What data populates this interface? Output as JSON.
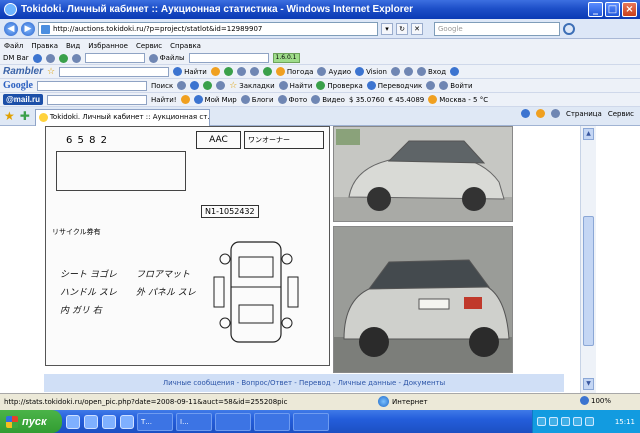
{
  "window": {
    "title": "Tokidoki. Личный кабинет :: Аукционная статистика - Windows Internet Explorer",
    "minimize": "_",
    "maximize": "□",
    "close": "×"
  },
  "address": {
    "url": "http://auctions.tokidoki.ru/?p=project/statlot&id=12989907",
    "search_placeholder": "Google"
  },
  "menu": [
    "Файл",
    "Правка",
    "Вид",
    "Избранное",
    "Сервис",
    "Справка"
  ],
  "toolbar_dm": {
    "label": "DM Bar",
    "files": "Файлы",
    "counter": "1.6.0.1"
  },
  "toolbar_rambler": {
    "brand": "Rambler",
    "find": "Найти",
    "weather": "Погода",
    "audio": "Аудио",
    "vision": "Vision",
    "login": "Вход"
  },
  "toolbar_google": {
    "brand": "Google",
    "search": "Поиск",
    "bookmarks": "Закладки",
    "find": "Найти",
    "check": "Проверка",
    "translate": "Переводчик",
    "signin": "Войти"
  },
  "toolbar_mailru": {
    "brand": "@mail.ru",
    "find": "Найти!",
    "my_world": "Мой Мир",
    "blogs": "Блоги",
    "photo": "Фото",
    "video": "Видео",
    "usd": "$ 35.0760",
    "eur": "€ 45.4089",
    "weather": "Москва - 5 °C"
  },
  "tabs": {
    "active": "Tokidoki. Личный кабинет :: Аукционная ст...",
    "page": "Страница",
    "tools": "Сервис"
  },
  "sheet": {
    "grade_label": "AAC",
    "number": "6 5 8 2",
    "recycle": "リサイクル券有",
    "code": "N1-1052432",
    "notes": "ワンオーナー",
    "hw1": "シート ヨゴレ",
    "hw2": "ハンドル スレ",
    "hw3": "外 パネル スレ",
    "hw4": "内 ガリ 右",
    "hw5": "フロアマット"
  },
  "footer_links": "Личные сообщения - Вопрос/Ответ - Перевод - Личные данные - Документы",
  "status": {
    "url": "http://stats.tokidoki.ru/open_pic.php?date=2008-09-11&auct=58&id=255208pic",
    "zone": "Интернет",
    "zoom": "100%"
  },
  "taskbar": {
    "start": "пуск",
    "task1": "Т...",
    "task2": "I...",
    "clock": "15:11"
  }
}
